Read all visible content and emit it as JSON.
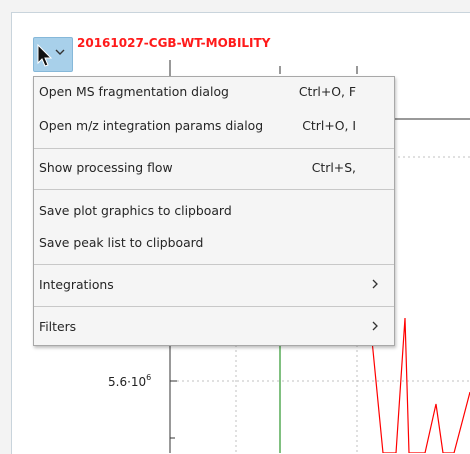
{
  "plot": {
    "title": "20161027-CGB-WT-MOBILITY",
    "title_color": "#ff1a1a",
    "y_tick": {
      "mantissa": "5.6·10",
      "exponent": "6"
    },
    "trace_color": "#ff0000",
    "marker_color": "#008000"
  },
  "menu_button": {
    "icon": "chevron-down-icon"
  },
  "context_menu": {
    "items": [
      {
        "label": "Open MS fragmentation dialog",
        "shortcut": "Ctrl+O, F"
      },
      {
        "label": "Open m/z integration params dialog",
        "shortcut": "Ctrl+O, I"
      },
      {
        "label": "Show processing flow",
        "shortcut": "Ctrl+S,"
      },
      {
        "label": "Save plot graphics to clipboard",
        "shortcut": ""
      },
      {
        "label": "Save peak list to clipboard",
        "shortcut": ""
      },
      {
        "label": "Integrations",
        "submenu_icon": "chevron-right-icon"
      },
      {
        "label": "Filters",
        "submenu_icon": "chevron-right-icon"
      }
    ]
  }
}
